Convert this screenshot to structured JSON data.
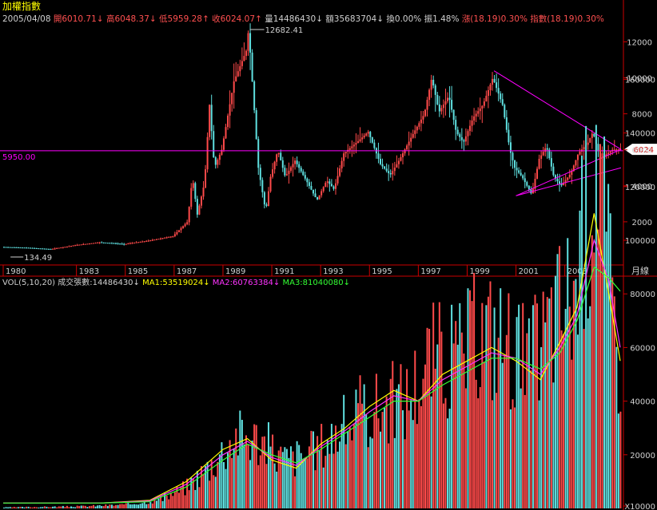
{
  "colors": {
    "background": "#000000",
    "up": "#ff4a4a",
    "down": "#5fe0e0",
    "axis": "#cc0000",
    "grid": "#7a0000",
    "text": "#d0d0d0",
    "magenta": "#ff00ff",
    "ma1": "#ffff00",
    "ma2": "#ff33ff",
    "ma3": "#33ff33",
    "label_yellow": "#ffff00",
    "label_red": "#ff5050"
  },
  "header": {
    "title": "加權指數",
    "date": "2005/04/08",
    "open_label": "開",
    "open_value": "6010.71",
    "open_arrow": "↓",
    "high_label": "高",
    "high_value": "6048.37",
    "high_arrow": "↓",
    "low_label": "低",
    "low_value": "5959.28",
    "low_arrow": "↑",
    "close_label": "收",
    "close_value": "6024.07",
    "close_arrow": "↑",
    "volume_label": "量",
    "volume_value": "14486430",
    "volume_arrow": "↓",
    "amount_label": "額",
    "amount_value": "35683704",
    "amount_arrow": "↓",
    "turnover": "換0.00%",
    "amplitude": "振1.48%",
    "change": "漲(18.19)0.30%",
    "index_change": "指數(18.19)0.30%"
  },
  "vol_header": {
    "indicator": "VOL(5,10,20)",
    "volume": "成交張數:14486430↓",
    "ma1": "MA1:53519024↓",
    "ma2": "MA2:60763384↓",
    "ma3": "MA3:81040080↓"
  },
  "chart_data": [
    {
      "type": "candlestick",
      "title": "加權指數",
      "period_label": "月線",
      "ylim": [
        0,
        13000
      ],
      "y_ticks": [
        "2000",
        "4000",
        "6000",
        "8000",
        "10000",
        "12000"
      ],
      "x_ticks": [
        "1980",
        "1983",
        "1985",
        "1987",
        "1989",
        "1991",
        "1993",
        "1995",
        "1997",
        "1999",
        "2001",
        "2003"
      ],
      "annotations": {
        "max_label": "12682.41",
        "min_label": "134.49",
        "reference_line_label": "5950.00",
        "last_price_label": "6024"
      },
      "reference_line": 5950,
      "triangle": {
        "upper_start": {
          "year": 2000.1,
          "value": 10393
        },
        "apex": {
          "year": 2005.3,
          "value": 6024
        },
        "lower_start": {
          "year": 2001.0,
          "value": 3446
        },
        "lower_end": {
          "year": 2005.3,
          "value": 5000
        }
      },
      "close_path": [
        [
          1980.0,
          600
        ],
        [
          1981.0,
          560
        ],
        [
          1982.0,
          480
        ],
        [
          1983.0,
          700
        ],
        [
          1984.0,
          860
        ],
        [
          1985.0,
          760
        ],
        [
          1986.0,
          950
        ],
        [
          1987.0,
          1200
        ],
        [
          1987.6,
          2000
        ],
        [
          1987.8,
          4500
        ],
        [
          1988.0,
          2400
        ],
        [
          1988.3,
          4200
        ],
        [
          1988.5,
          8500
        ],
        [
          1988.7,
          5000
        ],
        [
          1989.0,
          6000
        ],
        [
          1989.5,
          9800
        ],
        [
          1990.0,
          11500
        ],
        [
          1990.1,
          12682
        ],
        [
          1990.5,
          5000
        ],
        [
          1990.8,
          2560
        ],
        [
          1991.0,
          4500
        ],
        [
          1991.3,
          6000
        ],
        [
          1991.6,
          4500
        ],
        [
          1992.0,
          5400
        ],
        [
          1992.5,
          4200
        ],
        [
          1992.9,
          3200
        ],
        [
          1993.3,
          4300
        ],
        [
          1993.6,
          3800
        ],
        [
          1994.0,
          5800
        ],
        [
          1994.6,
          6500
        ],
        [
          1995.0,
          7000
        ],
        [
          1995.5,
          5200
        ],
        [
          1995.9,
          4600
        ],
        [
          1996.3,
          5500
        ],
        [
          1996.8,
          6800
        ],
        [
          1997.3,
          8000
        ],
        [
          1997.6,
          10000
        ],
        [
          1997.9,
          8100
        ],
        [
          1998.3,
          9000
        ],
        [
          1998.6,
          7000
        ],
        [
          1998.9,
          6400
        ],
        [
          1999.3,
          7800
        ],
        [
          1999.7,
          8500
        ],
        [
          2000.1,
          10000
        ],
        [
          2000.5,
          8500
        ],
        [
          2000.8,
          6000
        ],
        [
          2001.0,
          5000
        ],
        [
          2001.3,
          4500
        ],
        [
          2001.7,
          3500
        ],
        [
          2002.0,
          5500
        ],
        [
          2002.3,
          6200
        ],
        [
          2002.6,
          4500
        ],
        [
          2002.9,
          4000
        ],
        [
          2003.3,
          4700
        ],
        [
          2003.6,
          5800
        ],
        [
          2004.0,
          6400
        ],
        [
          2004.2,
          7000
        ],
        [
          2004.5,
          5500
        ],
        [
          2004.8,
          5800
        ],
        [
          2005.0,
          6000
        ],
        [
          2005.27,
          6024
        ]
      ]
    },
    {
      "type": "bar",
      "title": "VOL(5,10,20)",
      "ylim": [
        10000,
        170000
      ],
      "y_ticks": [
        "20000",
        "40000",
        "60000",
        "80000",
        "100000",
        "120000",
        "140000",
        "160000",
        "X10000"
      ],
      "series": [
        {
          "name": "MA1",
          "values": [
            0,
            200,
            500,
            1000,
            3000,
            10000,
            22000,
            26000,
            18000,
            15000,
            24000,
            30000,
            38000,
            44000,
            40000,
            50000,
            55000,
            60000,
            55000,
            48000,
            62000,
            75000,
            110000,
            80000,
            55000
          ]
        },
        {
          "name": "MA2",
          "values": [
            0,
            200,
            450,
            900,
            2800,
            9000,
            20000,
            25000,
            19000,
            16000,
            23000,
            29000,
            36000,
            42000,
            40000,
            48000,
            53000,
            58000,
            56000,
            50000,
            60000,
            72000,
            100000,
            85000,
            60000
          ]
        },
        {
          "name": "MA3",
          "values": [
            0,
            180,
            400,
            800,
            2500,
            8000,
            18000,
            24000,
            20000,
            17000,
            22000,
            28000,
            34000,
            40000,
            40000,
            46000,
            51000,
            56000,
            56000,
            52000,
            58000,
            70000,
            90000,
            86000,
            81000
          ]
        }
      ],
      "x": [
        1980,
        1981,
        1982,
        1983,
        1984,
        1985,
        1986,
        1987,
        1988,
        1989,
        1990,
        1991,
        1992,
        1993,
        1994,
        1995,
        1996,
        1997,
        1998,
        1999,
        2000,
        2001,
        2002,
        2003,
        2004
      ],
      "ma_x": [
        1980,
        1981.5,
        1982.5,
        1984,
        1986,
        1987.5,
        1989,
        1990,
        1991,
        1992,
        1993,
        1994,
        1995,
        1996,
        1997,
        1998,
        1999,
        2000,
        2001,
        2002,
        2002.8,
        2003.5,
        2004.2,
        2004.8,
        2005.27
      ],
      "volume_envelope": [
        [
          1980.0,
          400
        ],
        [
          1983.0,
          800
        ],
        [
          1985.0,
          1500
        ],
        [
          1986.5,
          4000
        ],
        [
          1987.5,
          9000
        ],
        [
          1988.5,
          18000
        ],
        [
          1989.5,
          30000
        ],
        [
          1990.5,
          28000
        ],
        [
          1991.5,
          20000
        ],
        [
          1992.5,
          22000
        ],
        [
          1993.5,
          30000
        ],
        [
          1994.5,
          38000
        ],
        [
          1995.5,
          42000
        ],
        [
          1996.5,
          45000
        ],
        [
          1997.5,
          62000
        ],
        [
          1998.5,
          60000
        ],
        [
          1999.5,
          72000
        ],
        [
          2000.5,
          70000
        ],
        [
          2001.5,
          58000
        ],
        [
          2002.5,
          78000
        ],
        [
          2003.5,
          92000
        ],
        [
          2004.0,
          128000
        ],
        [
          2004.3,
          166000
        ],
        [
          2004.6,
          110000
        ],
        [
          2005.27,
          55000
        ]
      ]
    }
  ]
}
